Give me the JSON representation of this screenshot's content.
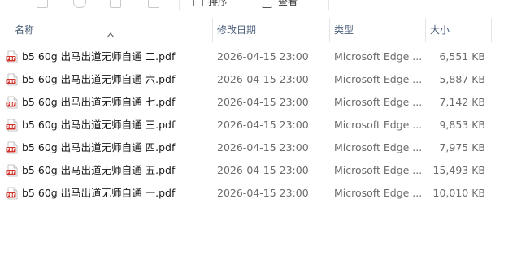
{
  "toolbar": {
    "sort_label": "排序",
    "view_label": "查看"
  },
  "columns": {
    "name": "名称",
    "modified": "修改日期",
    "type": "类型",
    "size": "大小"
  },
  "files": [
    {
      "name": "b5 60g   出马出道无师自通  二.pdf",
      "modified": "2026-04-15 23:00",
      "type": "Microsoft Edge ...",
      "size": "6,551 KB"
    },
    {
      "name": "b5 60g   出马出道无师自通  六.pdf",
      "modified": "2026-04-15 23:00",
      "type": "Microsoft Edge ...",
      "size": "5,887 KB"
    },
    {
      "name": "b5 60g   出马出道无师自通  七.pdf",
      "modified": "2026-04-15 23:00",
      "type": "Microsoft Edge ...",
      "size": "7,142 KB"
    },
    {
      "name": "b5 60g   出马出道无师自通  三.pdf",
      "modified": "2026-04-15 23:00",
      "type": "Microsoft Edge ...",
      "size": "9,853 KB"
    },
    {
      "name": "b5 60g   出马出道无师自通  四.pdf",
      "modified": "2026-04-15 23:00",
      "type": "Microsoft Edge ...",
      "size": "7,975 KB"
    },
    {
      "name": "b5 60g   出马出道无师自通  五.pdf",
      "modified": "2026-04-15 23:00",
      "type": "Microsoft Edge ...",
      "size": "15,493 KB"
    },
    {
      "name": "b5 60g   出马出道无师自通  一.pdf",
      "modified": "2026-04-15 23:00",
      "type": "Microsoft Edge ...",
      "size": "10,010 KB"
    }
  ],
  "icons": {
    "file_type": "pdf-file-icon",
    "sort": "sort-ascending-icon"
  },
  "colors": {
    "pdf_icon_red": "#d0342c",
    "header_text": "#4c607a",
    "secondary_text": "#6b6b6b"
  }
}
